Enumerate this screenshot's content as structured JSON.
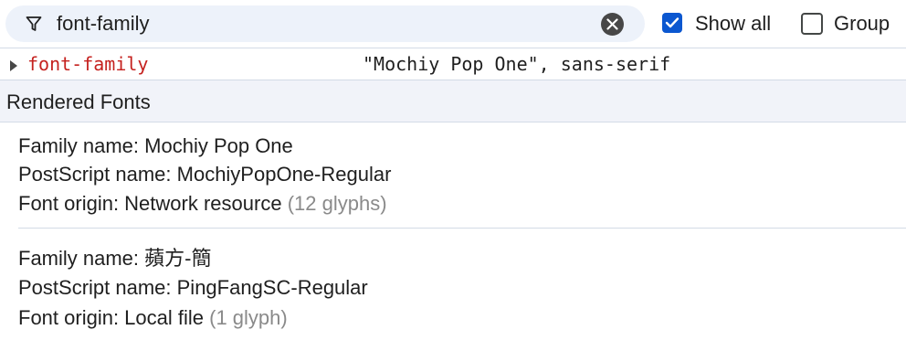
{
  "filter": {
    "value": "font-family",
    "icon": "filter-icon",
    "clear_icon": "clear-icon"
  },
  "options": {
    "show_all_label": "Show all",
    "show_all_checked": true,
    "group_label": "Group",
    "group_checked": false
  },
  "property": {
    "name": "font-family",
    "value": "\"Mochiy Pop One\", sans-serif"
  },
  "rendered_fonts": {
    "title": "Rendered Fonts",
    "entries": [
      {
        "family": "Family name: Mochiy Pop One",
        "postscript": "PostScript name: MochiyPopOne-Regular",
        "origin": "Font origin: Network resource",
        "glyphs": "(12 glyphs)"
      },
      {
        "family": "Family name: 蘋方-簡",
        "postscript": "PostScript name: PingFangSC-Regular",
        "origin": "Font origin: Local file",
        "glyphs": "(1 glyph)"
      }
    ]
  },
  "colors": {
    "accent": "#0b57d0",
    "property_name": "#c5221f",
    "filter_bg": "#edf2fa",
    "section_bg": "#f1f3f9",
    "muted": "#8a8a8a"
  }
}
